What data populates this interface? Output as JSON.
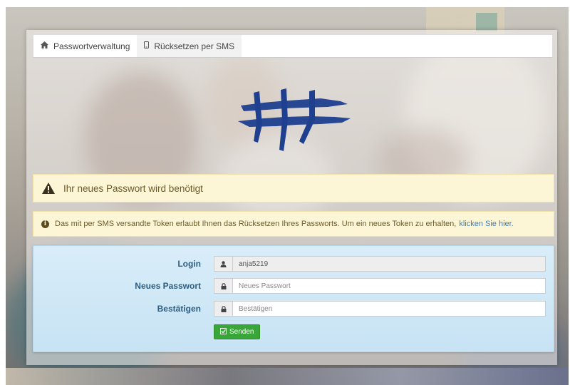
{
  "tabs": [
    {
      "label": "Passwortverwaltung",
      "icon": "home-icon"
    },
    {
      "label": "Rücksetzen per SMS",
      "icon": "phone-icon"
    }
  ],
  "alerts": {
    "warning_text": "Ihr neues Passwort wird benötigt",
    "info_text": "Das mit per SMS versandte Token erlaubt Ihnen das Rücksetzen Ihres Passworts. Um ein neues Token zu erhalten,",
    "info_link": "klicken Sie hier."
  },
  "form": {
    "login_label": "Login",
    "login_value": "anja5219",
    "new_password_label": "Neues Passwort",
    "new_password_placeholder": "Neues Passwort",
    "confirm_label": "Bestätigen",
    "confirm_placeholder": "Bestätigen",
    "submit_label": "Senden"
  },
  "colors": {
    "accent": "#3aa63a",
    "link": "#3a7fc0",
    "logo": "#1f3f8f",
    "warning_bg": "#fcf5d6",
    "form_bg": "#d9edf9"
  }
}
